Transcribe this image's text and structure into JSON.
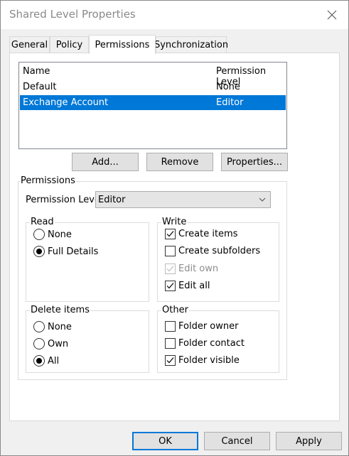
{
  "window": {
    "title": "Shared Level Properties"
  },
  "tabs": [
    {
      "label": "General",
      "active": false
    },
    {
      "label": "Policy",
      "active": false
    },
    {
      "label": "Permissions",
      "active": true
    },
    {
      "label": "Synchronization",
      "active": false
    }
  ],
  "list": {
    "headers": [
      "Name",
      "Permission Level"
    ],
    "rows": [
      {
        "name": "Default",
        "level": "None",
        "selected": false
      },
      {
        "name": "Exchange Account",
        "level": "Editor",
        "selected": true
      }
    ]
  },
  "list_buttons": {
    "add": "Add...",
    "remove": "Remove",
    "properties": "Properties..."
  },
  "permissions": {
    "group_label": "Permissions",
    "level_label": "Permission Level:",
    "level_value": "Editor",
    "read": {
      "label": "Read",
      "options": [
        {
          "label": "None",
          "checked": false
        },
        {
          "label": "Full Details",
          "checked": true
        }
      ]
    },
    "write": {
      "label": "Write",
      "options": [
        {
          "label": "Create items",
          "checked": true,
          "enabled": true
        },
        {
          "label": "Create subfolders",
          "checked": false,
          "enabled": true
        },
        {
          "label": "Edit own",
          "checked": true,
          "enabled": false
        },
        {
          "label": "Edit all",
          "checked": true,
          "enabled": true
        }
      ]
    },
    "delete": {
      "label": "Delete items",
      "options": [
        {
          "label": "None",
          "checked": false
        },
        {
          "label": "Own",
          "checked": false
        },
        {
          "label": "All",
          "checked": true
        }
      ]
    },
    "other": {
      "label": "Other",
      "options": [
        {
          "label": "Folder owner",
          "checked": false
        },
        {
          "label": "Folder contact",
          "checked": false
        },
        {
          "label": "Folder visible",
          "checked": true
        }
      ]
    }
  },
  "footer": {
    "ok": "OK",
    "cancel": "Cancel",
    "apply": "Apply"
  },
  "icons": {
    "close": "close-icon",
    "dropdown": "chevron-down-icon",
    "check": "checkmark-icon"
  },
  "colors": {
    "selection": "#0078d7",
    "title_text": "#8a8a8a"
  }
}
